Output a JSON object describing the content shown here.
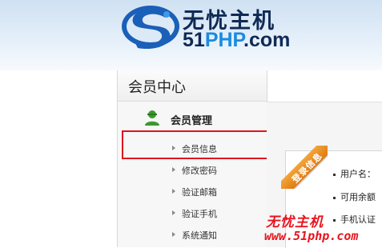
{
  "header": {
    "logo_cn": "无忧主机",
    "logo_en_prefix": "51",
    "logo_en_highlight": "PHP",
    "logo_en_suffix": ".com"
  },
  "sidebar": {
    "title": "会员中心",
    "section": {
      "label": "会员管理",
      "icon": "user-icon"
    },
    "items": [
      {
        "label": "会员信息",
        "selected": true
      },
      {
        "label": "修改密码"
      },
      {
        "label": "验证邮箱"
      },
      {
        "label": "验证手机"
      },
      {
        "label": "系统通知"
      }
    ]
  },
  "panel": {
    "ribbon_label": "登录信息",
    "rows": [
      {
        "label": "用户名："
      },
      {
        "label": "可用余额"
      },
      {
        "label": "手机认证"
      }
    ]
  },
  "watermark": {
    "cn": "无忧主机",
    "url": "www.51php.com"
  },
  "colors": {
    "highlight_border": "#e0141e",
    "logo_dark": "#102a55",
    "logo_accent": "#1a8be0",
    "ribbon": "#e8891e",
    "watermark": "#e8141e"
  }
}
